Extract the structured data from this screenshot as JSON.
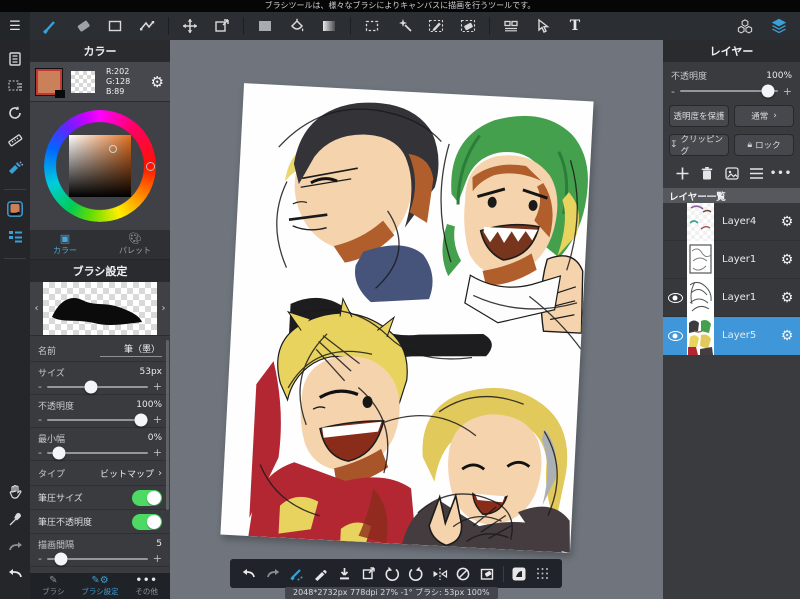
{
  "header": {
    "tooltip": "ブラシツールは、様々なブラシによりキャンバスに描画を行うツールです。",
    "text_tool_label": "T"
  },
  "color_panel": {
    "title": "カラー",
    "rgb_r": "R:202",
    "rgb_g": "G:128",
    "rgb_b": "B:89",
    "foreground_color": "#ca8059",
    "tab_color": "カラー",
    "tab_palette": "パレット"
  },
  "brush_panel": {
    "title": "ブラシ設定",
    "name_label": "名前",
    "name_value": "筆（墨）",
    "size_label": "サイズ",
    "size_value": "53px",
    "opacity_label": "不透明度",
    "opacity_value": "100%",
    "min_width_label": "最小幅",
    "min_width_value": "0%",
    "type_label": "タイプ",
    "type_value": "ビットマップ",
    "pressure_size_label": "筆圧サイズ",
    "pressure_opacity_label": "筆圧不透明度",
    "interval_label": "描画間隔",
    "interval_value": "5"
  },
  "left_tabs": {
    "brush": "ブラシ",
    "brush_settings": "ブラシ設定",
    "other": "その他"
  },
  "layers_panel": {
    "title": "レイヤー",
    "opacity_label": "不透明度",
    "opacity_value": "100%",
    "protect_alpha": "透明度を保護",
    "blend_mode": "通常",
    "clipping": "クリッピング",
    "lock": "ロック",
    "list_header": "レイヤー一覧",
    "selected_color": "#3f97d9",
    "layers": [
      {
        "name": "Layer4",
        "visible": false,
        "selected": false
      },
      {
        "name": "Layer1",
        "visible": false,
        "selected": false
      },
      {
        "name": "Layer1",
        "visible": true,
        "selected": false
      },
      {
        "name": "Layer5",
        "visible": true,
        "selected": true
      }
    ]
  },
  "status_bar": {
    "text": "2048*2732px 778dpi 27% -1° ブラシ: 53px 100%"
  }
}
